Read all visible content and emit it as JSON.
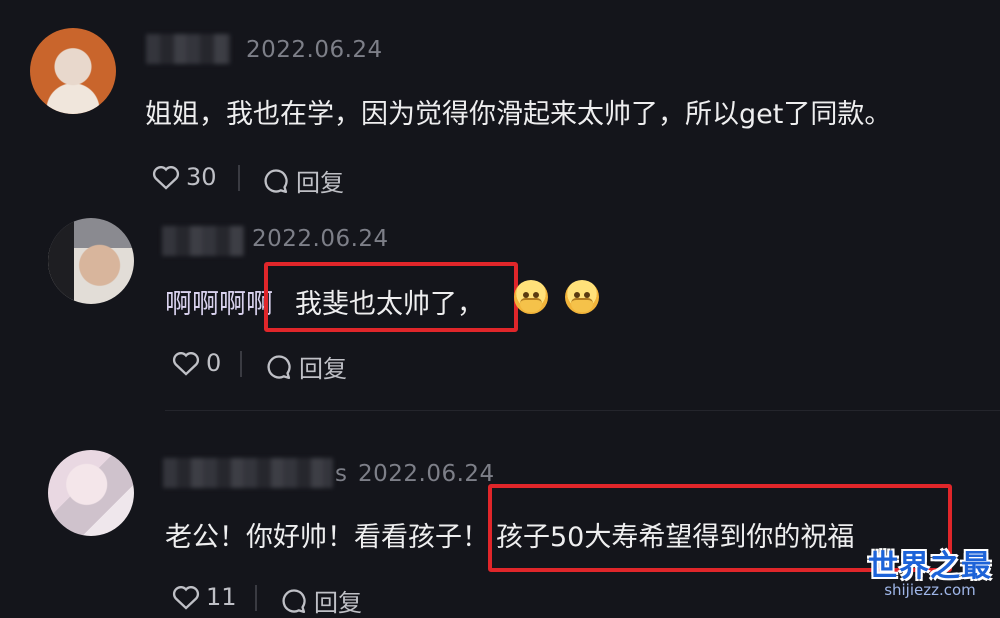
{
  "comments": [
    {
      "date": "2022.06.24",
      "text": "姐姐，我也在学，因为觉得你滑起来太帅了，所以get了同款。",
      "likes": "30",
      "reply_label": "回复"
    },
    {
      "date": "2022.06.24",
      "text_prefix": "啊啊啊啊",
      "text_highlight": "我斐也太帅了，",
      "likes": "0",
      "reply_label": "回复",
      "emoji": "pleading-face-hands"
    },
    {
      "date": "2022.06.24",
      "name_tail": "s",
      "text_prefix": "老公！你好帅！看看孩子！",
      "text_highlight": "孩子50大寿希望得到你的祝福",
      "likes": "11",
      "reply_label": "回复"
    }
  ],
  "watermark": {
    "main": "世界之最",
    "sub": "shijiezz.com"
  },
  "colors": {
    "background": "#14151b",
    "highlight_box": "#e0262a",
    "watermark_blue": "#1d63d8"
  }
}
